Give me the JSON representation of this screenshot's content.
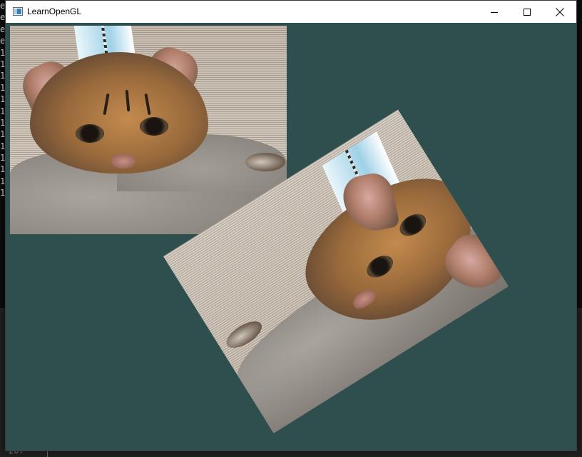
{
  "window": {
    "title": "LearnOpenGL",
    "app_icon": "window-app-icon",
    "controls": {
      "minimize_icon": "minimize-icon",
      "maximize_icon": "maximize-icon",
      "close_icon": "close-icon"
    }
  },
  "scene": {
    "clear_color": "#2f4f4f",
    "textures": [
      {
        "name": "cat-quad-upper-left",
        "rotation_deg": 180
      },
      {
        "name": "cat-quad-rotated",
        "rotation_deg": -32
      }
    ]
  },
  "background_console": {
    "left_column_chars": [
      "e",
      "e",
      "e",
      "e",
      "1",
      "1",
      "1",
      "1",
      "1",
      "1",
      "1",
      "1",
      "1",
      "1",
      "1",
      "1",
      "1"
    ],
    "bottom_line_number": "207"
  }
}
